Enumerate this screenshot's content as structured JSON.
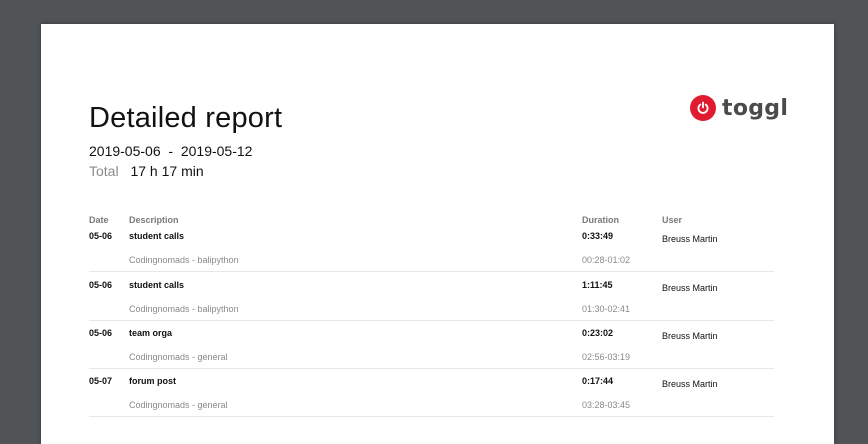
{
  "report": {
    "title": "Detailed report",
    "date_range": "2019-05-06  -  2019-05-12",
    "total_label": "Total",
    "total_value": "17 h 17 min"
  },
  "logo": {
    "text": "toggl",
    "icon": "power-icon",
    "color": "#e01b2f"
  },
  "table": {
    "headers": {
      "date": "Date",
      "description": "Description",
      "duration": "Duration",
      "user": "User"
    },
    "rows": [
      {
        "date": "05-06",
        "description": "student calls",
        "project": "Codingnomads - balipython",
        "duration": "0:33:49",
        "time_range": "00:28-01:02",
        "user": "Breuss Martin"
      },
      {
        "date": "05-06",
        "description": "student calls",
        "project": "Codingnomads - balipython",
        "duration": "1:11:45",
        "time_range": "01:30-02:41",
        "user": "Breuss Martin"
      },
      {
        "date": "05-06",
        "description": "team orga",
        "project": "Codingnomads - general",
        "duration": "0:23:02",
        "time_range": "02:56-03:19",
        "user": "Breuss Martin"
      },
      {
        "date": "05-07",
        "description": "forum post",
        "project": "Codingnomads - general",
        "duration": "0:17:44",
        "time_range": "03:28-03:45",
        "user": "Breuss Martin"
      }
    ]
  }
}
